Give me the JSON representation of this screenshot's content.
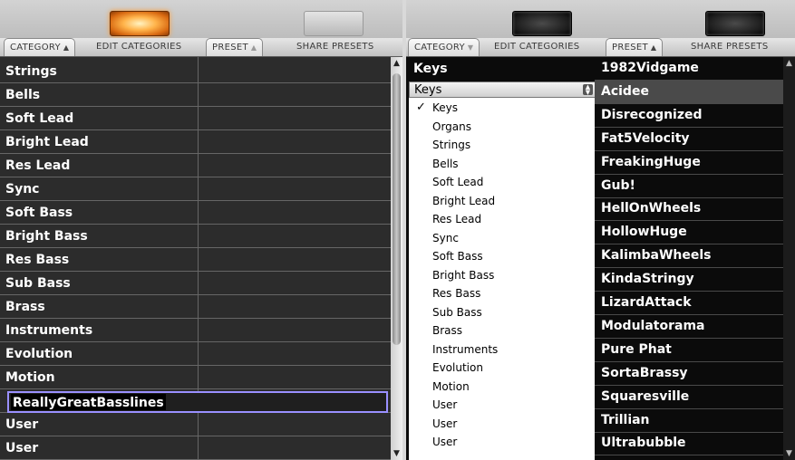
{
  "left": {
    "tabs": {
      "category": "CATEGORY",
      "edit_categories": "EDIT CATEGORIES",
      "preset": "PRESET",
      "share_presets": "SHARE PRESETS"
    },
    "categories": [
      "Strings",
      "Bells",
      "Soft Lead",
      "Bright Lead",
      "Res Lead",
      "Sync",
      "Soft Bass",
      "Bright Bass",
      "Res Bass",
      "Sub Bass",
      "Brass",
      "Instruments",
      "Evolution",
      "Motion",
      "User",
      "User"
    ],
    "editing_value": "ReallyGreatBasslines"
  },
  "right": {
    "tabs": {
      "category": "CATEGORY",
      "edit_categories": "EDIT CATEGORIES",
      "preset": "PRESET",
      "share_presets": "SHARE PRESETS"
    },
    "category_header": "Keys",
    "popup_value": "Keys",
    "checkmark": "✓",
    "menu_items": [
      "Keys",
      "Organs",
      "Strings",
      "Bells",
      "Soft Lead",
      "Bright Lead",
      "Res Lead",
      "Sync",
      "Soft Bass",
      "Bright Bass",
      "Res Bass",
      "Sub Bass",
      "Brass",
      "Instruments",
      "Evolution",
      "Motion",
      "User",
      "User",
      "User"
    ],
    "presets": [
      "1982Vidgame",
      "Acidee",
      "Disrecognized",
      "Fat5Velocity",
      "FreakingHuge",
      "Gub!",
      "HellOnWheels",
      "HollowHuge",
      "KalimbaWheels",
      "KindaStringy",
      "LizardAttack",
      "Modulatorama",
      "Pure Phat",
      "SortaBrassy",
      "Squaresville",
      "Trillian",
      "Ultrabubble"
    ],
    "selected_preset_index": 1
  },
  "colors": {
    "led_on": "#ffb34a",
    "list_bg": "#2c2c2c",
    "edit_border": "#9a90ff"
  }
}
